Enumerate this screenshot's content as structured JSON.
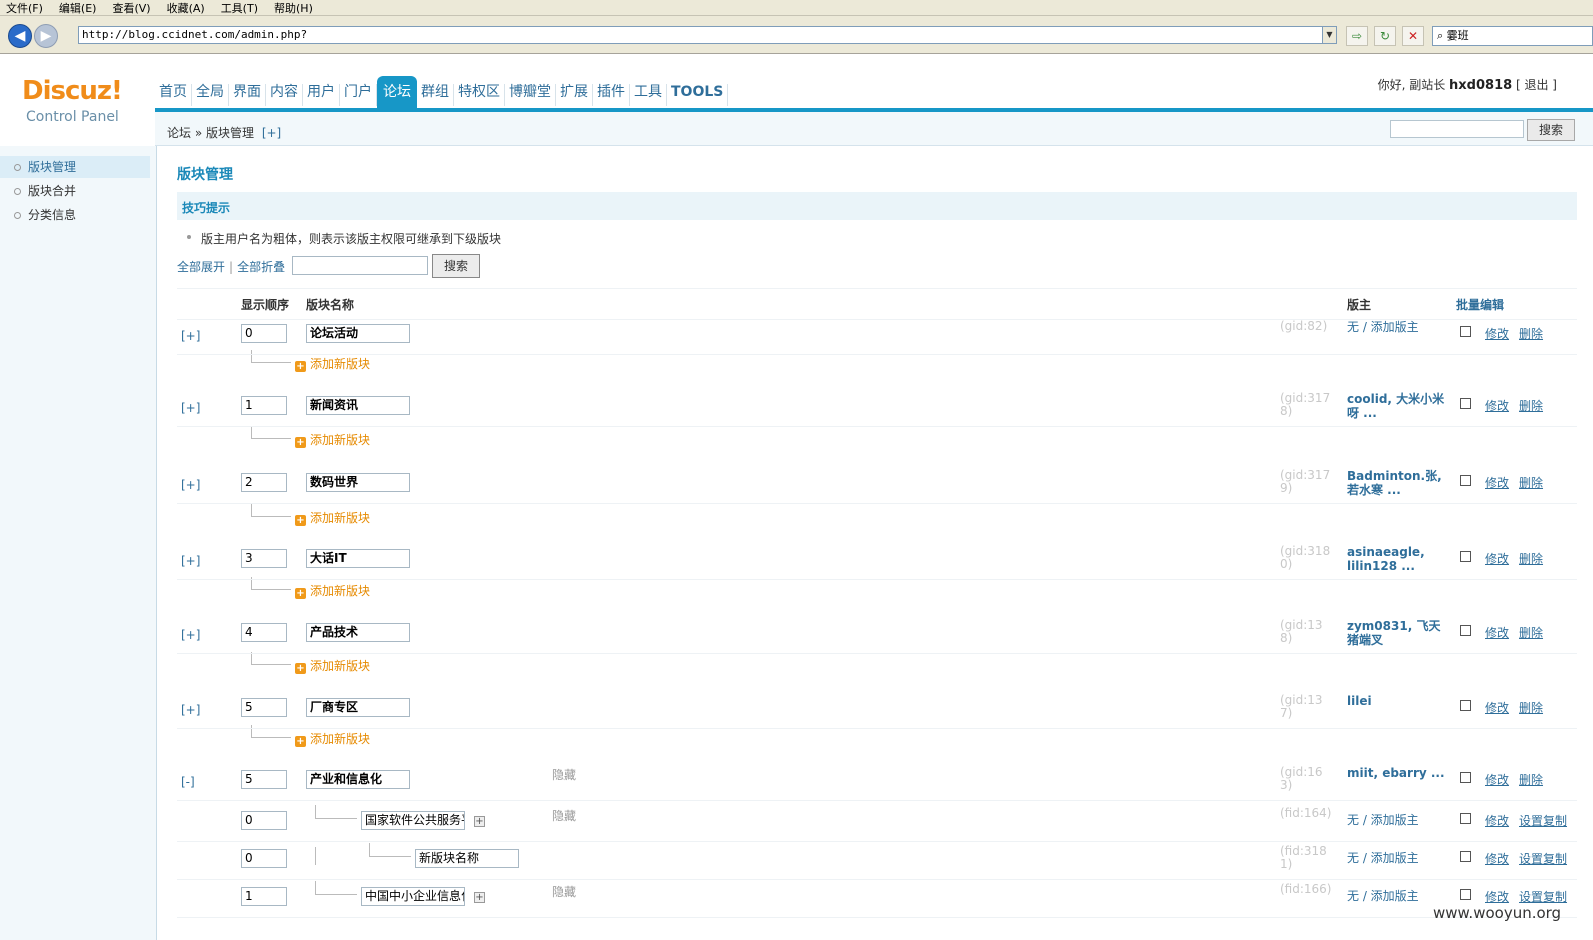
{
  "browser": {
    "menu": [
      "文件(F)",
      "编辑(E)",
      "查看(V)",
      "收藏(A)",
      "工具(T)",
      "帮助(H)"
    ],
    "url": "http://blog.ccidnet.com/admin.php?",
    "search_text": "霎班"
  },
  "header": {
    "logo": "Discuz!",
    "logo_sub": "Control Panel",
    "nav": [
      "首页",
      "全局",
      "界面",
      "内容",
      "用户",
      "门户",
      "论坛",
      "群组",
      "特权区",
      "博瓣堂",
      "扩展",
      "插件",
      "工具",
      "TOOLS"
    ],
    "active_nav": "论坛",
    "greeting": "你好, 副站长",
    "username": "hxd0818",
    "logout": "[ 退出 ]"
  },
  "breadcrumb": {
    "text": "论坛 » 版块管理",
    "toggle": "[+]",
    "search_button": "搜索"
  },
  "sidebar": {
    "items": [
      "版块管理",
      "版块合并",
      "分类信息"
    ],
    "selected": 0
  },
  "main": {
    "title": "版块管理",
    "tips_title": "技巧提示",
    "tip": "版主用户名为粗体，则表示该版主权限可继承到下级版块",
    "expand_all": "全部展开",
    "collapse_all": "全部折叠",
    "search_button": "搜索",
    "headers": {
      "order": "显示顺序",
      "name": "版块名称",
      "moderators": "版主",
      "batch": "批量编辑"
    },
    "add_forum": "添加新版块",
    "edit": "修改",
    "delete": "删除",
    "copy_settings": "设置复制",
    "hidden_label": "隐藏"
  },
  "rows": [
    {
      "toggle": "[+]",
      "order": "0",
      "name": "论坛活动",
      "gid": "(gid:82)",
      "mods": "无 / 添加版主",
      "mods_bold": false
    },
    {
      "toggle": "[+]",
      "order": "1",
      "name": "新闻资讯",
      "gid": "(gid:3178)",
      "mods": "coolid, 大米小米呀 ...",
      "mods_bold": true
    },
    {
      "toggle": "[+]",
      "order": "2",
      "name": "数码世界",
      "gid": "(gid:3179)",
      "mods": "Badminton.张, 若水寒 ...",
      "mods_bold": true
    },
    {
      "toggle": "[+]",
      "order": "3",
      "name": "大话IT",
      "gid": "(gid:3180)",
      "mods": "asinaeagle, lilin128 ...",
      "mods_bold": true
    },
    {
      "toggle": "[+]",
      "order": "4",
      "name": "产品技术",
      "gid": "(gid:138)",
      "mods": "zym0831, 飞天猪端叉",
      "mods_bold": true
    },
    {
      "toggle": "[+]",
      "order": "5",
      "name": "厂商专区",
      "gid": "(gid:137)",
      "mods": "lilei",
      "mods_bold": true
    },
    {
      "toggle": "[-]",
      "order": "5",
      "name": "产业和信息化",
      "gid": "(gid:163)",
      "mods": "miit, ebarry ...",
      "mods_bold": true,
      "hidden": true
    }
  ],
  "subrows": [
    {
      "order": "0",
      "name": "国家软件公共服务平台",
      "gid": "(fid:164)",
      "mods": "无 / 添加版主",
      "hidden": true
    },
    {
      "order": "0",
      "name": "新版块名称",
      "gid": "(fid:3181)",
      "mods": "无 / 添加版主"
    },
    {
      "order": "1",
      "name": "中国中小企业信息化",
      "gid": "(fid:166)",
      "mods": "无 / 添加版主",
      "hidden": true
    }
  ],
  "watermark": "www.wooyun.org",
  "colors": {
    "accent": "#1797c7",
    "link": "#2f6e9a",
    "logo": "#f08c1a"
  }
}
